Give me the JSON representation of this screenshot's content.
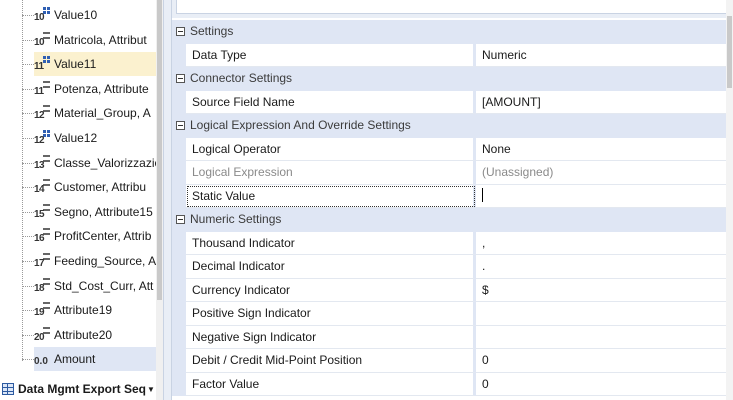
{
  "tree": {
    "items": [
      {
        "num": "10",
        "icon": "grid-icon",
        "label": "Value10",
        "state": "normal"
      },
      {
        "num": "10",
        "icon": "bars-icon",
        "label": "Matricola, Attribut",
        "state": "normal"
      },
      {
        "num": "11",
        "icon": "grid-icon",
        "label": "Value11",
        "state": "selected"
      },
      {
        "num": "11",
        "icon": "bars-icon",
        "label": "Potenza, Attribute",
        "state": "normal"
      },
      {
        "num": "12",
        "icon": "bars-icon",
        "label": "Material_Group, A",
        "state": "normal"
      },
      {
        "num": "12",
        "icon": "grid-icon",
        "label": "Value12",
        "state": "normal"
      },
      {
        "num": "13",
        "icon": "bars-icon",
        "label": "Classe_Valorizzazio",
        "state": "normal"
      },
      {
        "num": "14",
        "icon": "bars-icon",
        "label": "Customer, Attribu",
        "state": "normal"
      },
      {
        "num": "15",
        "icon": "bars-icon",
        "label": "Segno, Attribute15",
        "state": "normal"
      },
      {
        "num": "16",
        "icon": "bars-icon",
        "label": "ProfitCenter, Attrib",
        "state": "normal"
      },
      {
        "num": "17",
        "icon": "bars-icon",
        "label": "Feeding_Source, A",
        "state": "normal"
      },
      {
        "num": "18",
        "icon": "bars-icon",
        "label": "Std_Cost_Curr, Att",
        "state": "normal"
      },
      {
        "num": "19",
        "icon": "bars-icon",
        "label": "Attribute19",
        "state": "normal"
      },
      {
        "num": "20",
        "icon": "bars-icon",
        "label": "Attribute20",
        "state": "normal"
      },
      {
        "num": "0.0",
        "icon": "decimal-icon",
        "label": "Amount",
        "state": "hot"
      }
    ],
    "footer": {
      "label": "Data Mgmt Export Seq",
      "icon": "table-icon"
    }
  },
  "grid": {
    "rows": [
      {
        "kind": "category",
        "label": "Settings"
      },
      {
        "kind": "property",
        "name": "Data Type",
        "value": "Numeric"
      },
      {
        "kind": "category",
        "label": "Connector Settings"
      },
      {
        "kind": "property",
        "name": "Source Field Name",
        "value": "[AMOUNT]"
      },
      {
        "kind": "category",
        "label": "Logical Expression And Override Settings"
      },
      {
        "kind": "property",
        "name": "Logical Operator",
        "value": "None"
      },
      {
        "kind": "property",
        "name": "Logical Expression",
        "value": "(Unassigned)",
        "disabled": true
      },
      {
        "kind": "property",
        "name": "Static Value",
        "value": "",
        "focused": true
      },
      {
        "kind": "category",
        "label": "Numeric Settings"
      },
      {
        "kind": "property",
        "name": "Thousand Indicator",
        "value": ","
      },
      {
        "kind": "property",
        "name": "Decimal Indicator",
        "value": "."
      },
      {
        "kind": "property",
        "name": "Currency Indicator",
        "value": "$"
      },
      {
        "kind": "property",
        "name": "Positive Sign Indicator",
        "value": ""
      },
      {
        "kind": "property",
        "name": "Negative Sign Indicator",
        "value": ""
      },
      {
        "kind": "property",
        "name": "Debit / Credit Mid-Point Position",
        "value": "0"
      },
      {
        "kind": "property",
        "name": "Factor Value",
        "value": "0"
      }
    ]
  },
  "colors": {
    "category_bg": "#dfe6f4",
    "selected_bg": "#fbf1cf",
    "hot_bg": "#dfe6f4",
    "accent": "#2f5fb3"
  }
}
